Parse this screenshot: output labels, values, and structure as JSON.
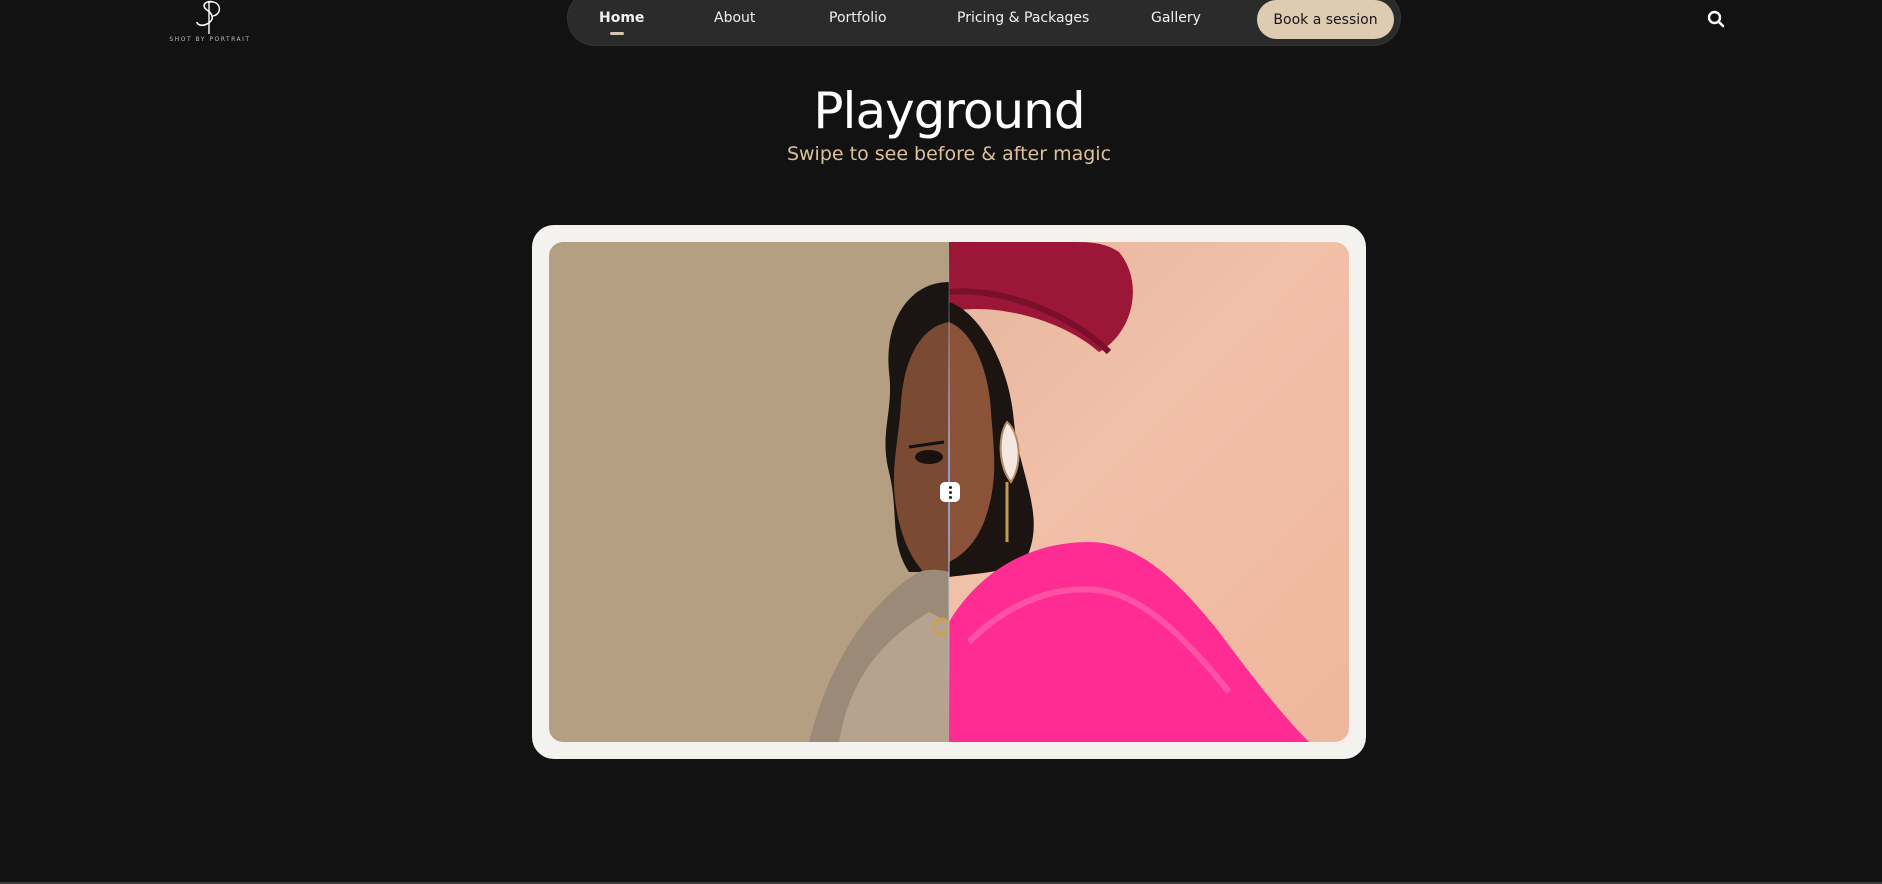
{
  "logo": {
    "caption": "SHOT BY PORTRAIT"
  },
  "nav": {
    "items": [
      {
        "label": "Home",
        "active": true
      },
      {
        "label": "About",
        "active": false
      },
      {
        "label": "Portfolio",
        "active": false
      },
      {
        "label": "Pricing & Packages",
        "active": false
      },
      {
        "label": "Gallery",
        "active": false
      }
    ],
    "cta_label": "Book a session",
    "search_icon": "search-icon"
  },
  "hero": {
    "title": "Playground",
    "subtitle": "Swipe to see before & after magic"
  },
  "comparison": {
    "slider_position": 0.5,
    "handle_icon": "vertical-dots-icon"
  },
  "colors": {
    "background": "#121212",
    "accent": "#ddcbb2",
    "subtitle": "#dcc29a"
  }
}
